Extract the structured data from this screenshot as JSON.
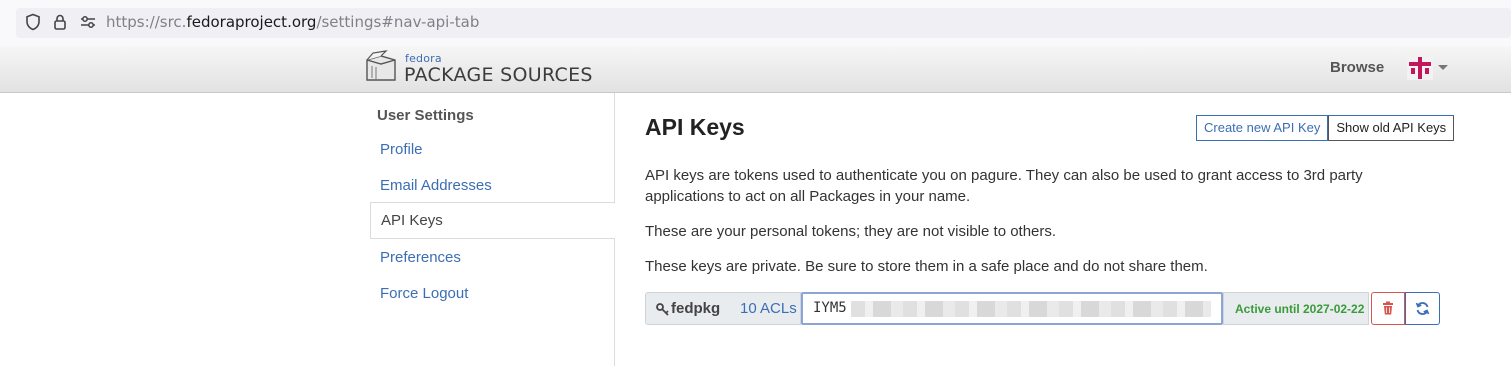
{
  "browser": {
    "url_prefix": "https://src.",
    "url_domain": "fedoraproject.org",
    "url_suffix": "/settings#nav-api-tab"
  },
  "header": {
    "logo_small": "fedora",
    "logo_big": "PACKAGE SOURCES",
    "browse": "Browse"
  },
  "sidebar": {
    "title": "User Settings",
    "items": [
      {
        "label": "Profile"
      },
      {
        "label": "Email Addresses"
      },
      {
        "label": "API Keys"
      },
      {
        "label": "Preferences"
      },
      {
        "label": "Force Logout"
      }
    ]
  },
  "main": {
    "title": "API Keys",
    "create_button": "Create new API Key",
    "old_button": "Show old API Keys",
    "para1": "API keys are tokens used to authenticate you on pagure. They can also be used to grant access to 3rd party applications to act on all Packages in your name.",
    "para2": "These are your personal tokens; they are not visible to others.",
    "para3": "These keys are private. Be sure to store them in a safe place and do not share them."
  },
  "key": {
    "name": "fedpkg",
    "acls": "10 ACLs",
    "value_visible": "IYM5",
    "status": "Active until 2027-02-22"
  },
  "colors": {
    "link": "#3c6eb4",
    "active_status": "#3a9b3a",
    "danger": "#d9534f"
  }
}
